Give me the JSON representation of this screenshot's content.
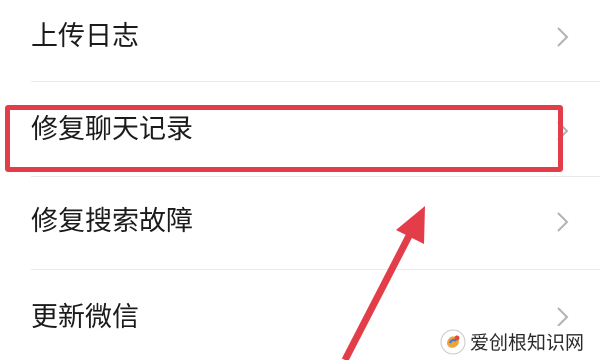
{
  "menu": {
    "items": [
      {
        "label": "上传日志",
        "icon": "chevron-right-icon"
      },
      {
        "label": "修复聊天记录",
        "icon": "chevron-right-icon"
      },
      {
        "label": "修复搜索故障",
        "icon": "chevron-right-icon"
      },
      {
        "label": "更新微信",
        "icon": "chevron-right-icon"
      }
    ]
  },
  "annotation": {
    "highlight_color": "#e43d4a",
    "arrow_color": "#e43d4a",
    "highlighted_item": "修复聊天记录"
  },
  "watermark": {
    "text": "爱创根知识网"
  }
}
